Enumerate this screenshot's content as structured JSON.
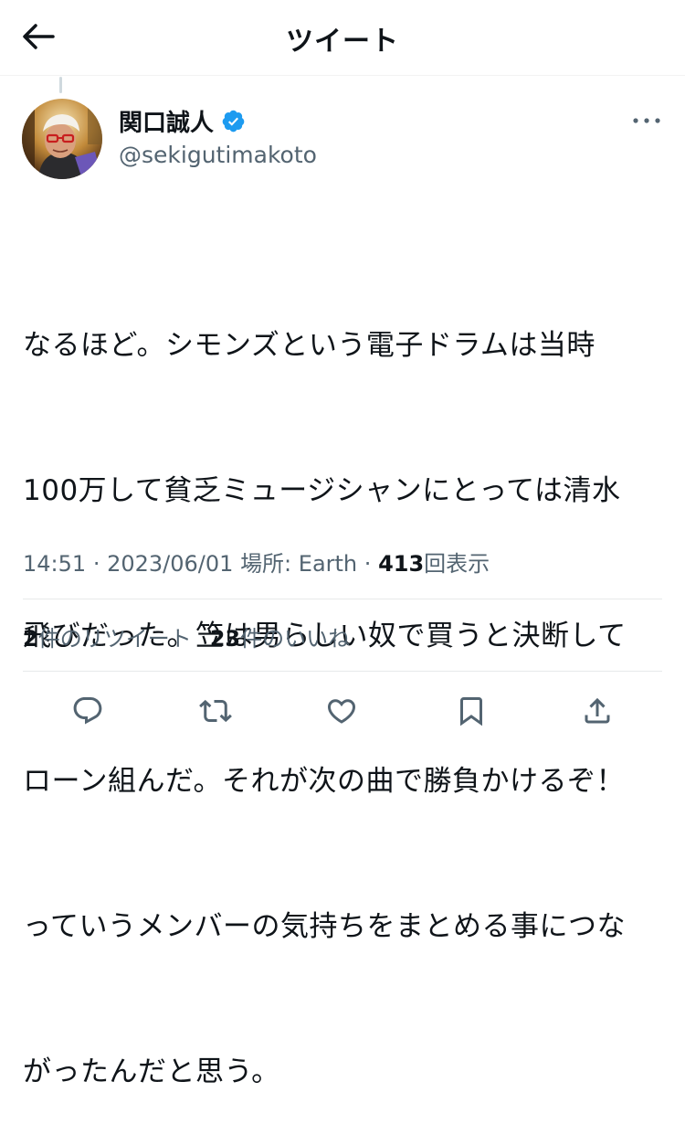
{
  "header": {
    "title": "ツイート"
  },
  "author": {
    "display_name": "関口誠人",
    "handle": "@sekigutimakoto",
    "verified": true
  },
  "tweet": {
    "text": "なるほど。シモンズという電子ドラムは当時100万して貧乏ミュージシャンにとっては清水飛びだった。笠は男らしい奴で買うと決断してローン組んだ。それが次の曲で勝負かけるぞ！っていうメンバーの気持ちをまとめる事につながったんだと思う。",
    "lines": [
      "なるほど。シモンズという電子ドラムは当時",
      "100万して貧乏ミュージシャンにとっては清水",
      "飛びだった。笠は男らしい奴で買うと決断して",
      "ローン組んだ。それが次の曲で勝負かけるぞ！",
      "っていうメンバーの気持ちをまとめる事につな",
      "がったんだと思う。"
    ],
    "time": "14:51",
    "date": "2023/06/01",
    "location_label": "場所: Earth",
    "separator": "·",
    "views_count": "413",
    "views_label": "回表示"
  },
  "stats": {
    "retweets_count": "2",
    "retweets_label": "件のリツイート",
    "likes_count": "23",
    "likes_label": "件のいいね"
  },
  "colors": {
    "text": "#0f1419",
    "secondary": "#536471",
    "verified": "#1d9bf0",
    "divider": "#e7e9ea"
  },
  "icons": {
    "back": "arrow-left-icon",
    "more": "more-dots-icon",
    "reply": "reply-icon",
    "retweet": "retweet-icon",
    "like": "heart-icon",
    "bookmark": "bookmark-icon",
    "share": "share-icon"
  }
}
